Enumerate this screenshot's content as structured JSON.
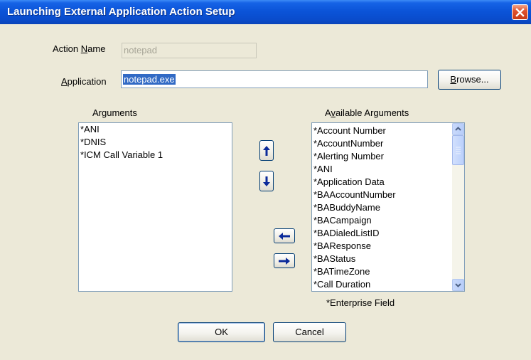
{
  "window": {
    "title": "Launching External Application Action Setup"
  },
  "action_name": {
    "label_pre": "Action ",
    "label_accel": "N",
    "label_post": "ame",
    "value": "notepad"
  },
  "application": {
    "label_accel": "A",
    "label_post": "pplication",
    "value": "notepad.exe"
  },
  "browse_button": {
    "accel": "B",
    "rest": "rowse..."
  },
  "arguments": {
    "heading_pre": "Ar",
    "heading_accel": "g",
    "heading_post": "uments",
    "items": [
      "*ANI",
      "*DNIS",
      "*ICM Call Variable 1"
    ]
  },
  "available_arguments": {
    "heading_pre": "A",
    "heading_accel": "v",
    "heading_post": "ailable Arguments",
    "items": [
      "*Account Number",
      "*AccountNumber",
      "*Alerting Number",
      "*ANI",
      "*Application Data",
      "*BAAccountNumber",
      "*BABuddyName",
      "*BACampaign",
      "*BADialedListID",
      "*BAResponse",
      "*BAStatus",
      "*BATimeZone",
      "*Call Duration"
    ],
    "scroll_position": 0.0
  },
  "footnote": "*Enterprise Field",
  "ok_button": "OK",
  "cancel_button": "Cancel",
  "icons": {
    "close": "close-icon",
    "move_up": "arrow-up-icon",
    "move_down": "arrow-down-icon",
    "add": "arrow-left-icon",
    "remove": "arrow-right-icon"
  },
  "colors": {
    "title_bar": "#0a4ccc",
    "dialog_bg": "#ece9d8",
    "selection": "#316ac5",
    "arrow_blue": "#0b2a9a"
  }
}
